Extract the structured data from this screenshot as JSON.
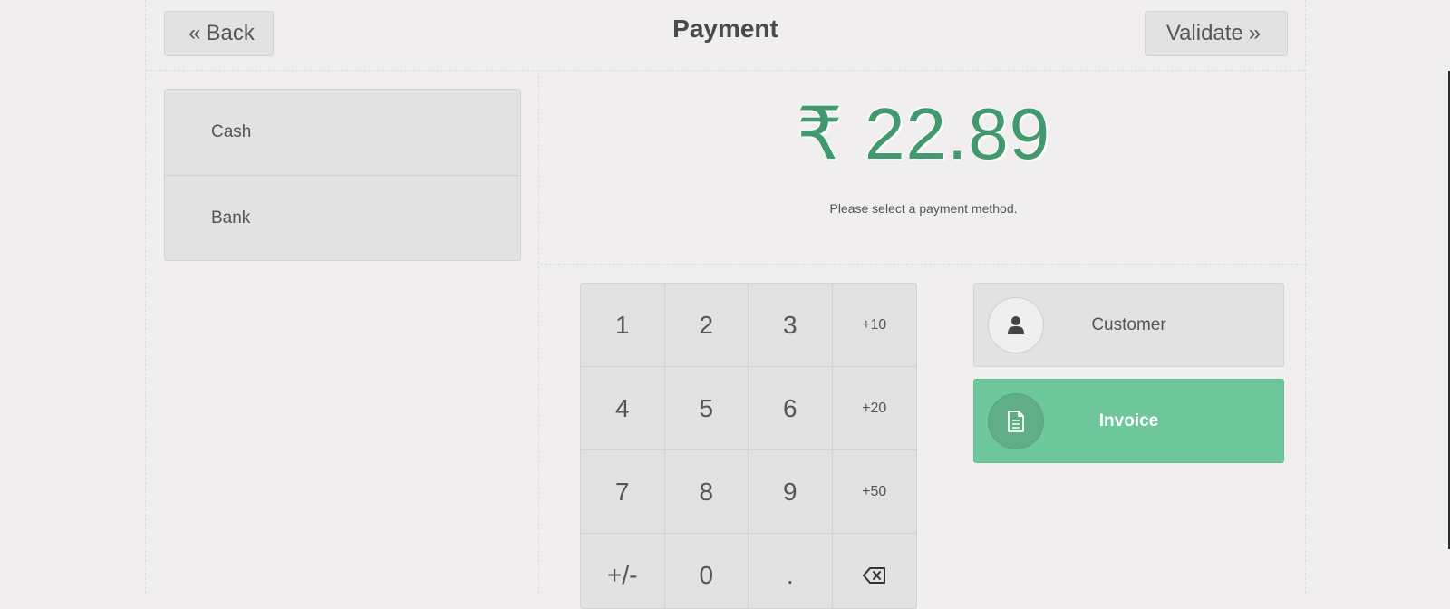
{
  "header": {
    "back_label": "Back",
    "title": "Payment",
    "validate_label": "Validate"
  },
  "payment_methods": [
    {
      "label": "Cash"
    },
    {
      "label": "Bank"
    }
  ],
  "summary": {
    "amount": "₹ 22.89",
    "hint": "Please select a payment method."
  },
  "numpad": {
    "keys": [
      "1",
      "2",
      "3",
      "+10",
      "4",
      "5",
      "6",
      "+20",
      "7",
      "8",
      "9",
      "+50",
      "+/-",
      "0",
      ".",
      "⌫"
    ]
  },
  "actions": {
    "customer_label": "Customer",
    "invoice_label": "Invoice"
  },
  "colors": {
    "amount": "#43996e",
    "invoice_active": "#6ec89b"
  },
  "icons": {
    "back": "chevron-double-left-icon",
    "validate": "chevron-double-right-icon",
    "customer": "user-icon",
    "invoice": "document-icon",
    "backspace": "backspace-icon"
  }
}
